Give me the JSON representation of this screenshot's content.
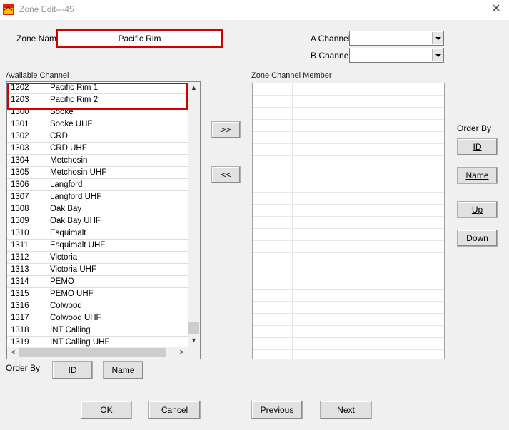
{
  "window": {
    "title": "Zone Edit---45",
    "close_glyph": "✕",
    "icon": "app-icon"
  },
  "zone_name": {
    "label": "Zone Name",
    "value": "Pacific Rim"
  },
  "channels": {
    "a_label": "A Channel",
    "a_value": "",
    "b_label": "B Channel",
    "b_value": ""
  },
  "available": {
    "label": "Available Channel",
    "rows": [
      {
        "id": "1202",
        "name": "Pacific Rim 1"
      },
      {
        "id": "1203",
        "name": "Pacific Rim 2"
      },
      {
        "id": "1300",
        "name": "Sooke"
      },
      {
        "id": "1301",
        "name": "Sooke UHF"
      },
      {
        "id": "1302",
        "name": "CRD"
      },
      {
        "id": "1303",
        "name": "CRD UHF"
      },
      {
        "id": "1304",
        "name": "Metchosin"
      },
      {
        "id": "1305",
        "name": "Metchosin UHF"
      },
      {
        "id": "1306",
        "name": "Langford"
      },
      {
        "id": "1307",
        "name": "Langford UHF"
      },
      {
        "id": "1308",
        "name": "Oak Bay"
      },
      {
        "id": "1309",
        "name": "Oak Bay UHF"
      },
      {
        "id": "1310",
        "name": "Esquimalt"
      },
      {
        "id": "1311",
        "name": "Esquimalt UHF"
      },
      {
        "id": "1312",
        "name": "Victoria"
      },
      {
        "id": "1313",
        "name": "Victoria UHF"
      },
      {
        "id": "1314",
        "name": "PEMO"
      },
      {
        "id": "1315",
        "name": "PEMO UHF"
      },
      {
        "id": "1316",
        "name": "Colwood"
      },
      {
        "id": "1317",
        "name": "Colwood UHF"
      },
      {
        "id": "1318",
        "name": "INT Calling"
      },
      {
        "id": "1319",
        "name": "INT Calling UHF"
      }
    ],
    "order_by_label": "Order By",
    "order_id_label": "ID",
    "order_name_label": "Name"
  },
  "member": {
    "label": "Zone Channel Member"
  },
  "transfer": {
    "add_label": ">>",
    "remove_label": "<<"
  },
  "member_order": {
    "label": "Order By",
    "id_label": "ID",
    "name_label": "Name",
    "up_label": "Up",
    "down_label": "Down"
  },
  "footer": {
    "ok_label": "OK",
    "cancel_label": "Cancel",
    "previous_label": "Previous",
    "next_label": "Next"
  },
  "colors": {
    "highlight": "#d00000",
    "dialog_bg": "#f0f0f0"
  }
}
